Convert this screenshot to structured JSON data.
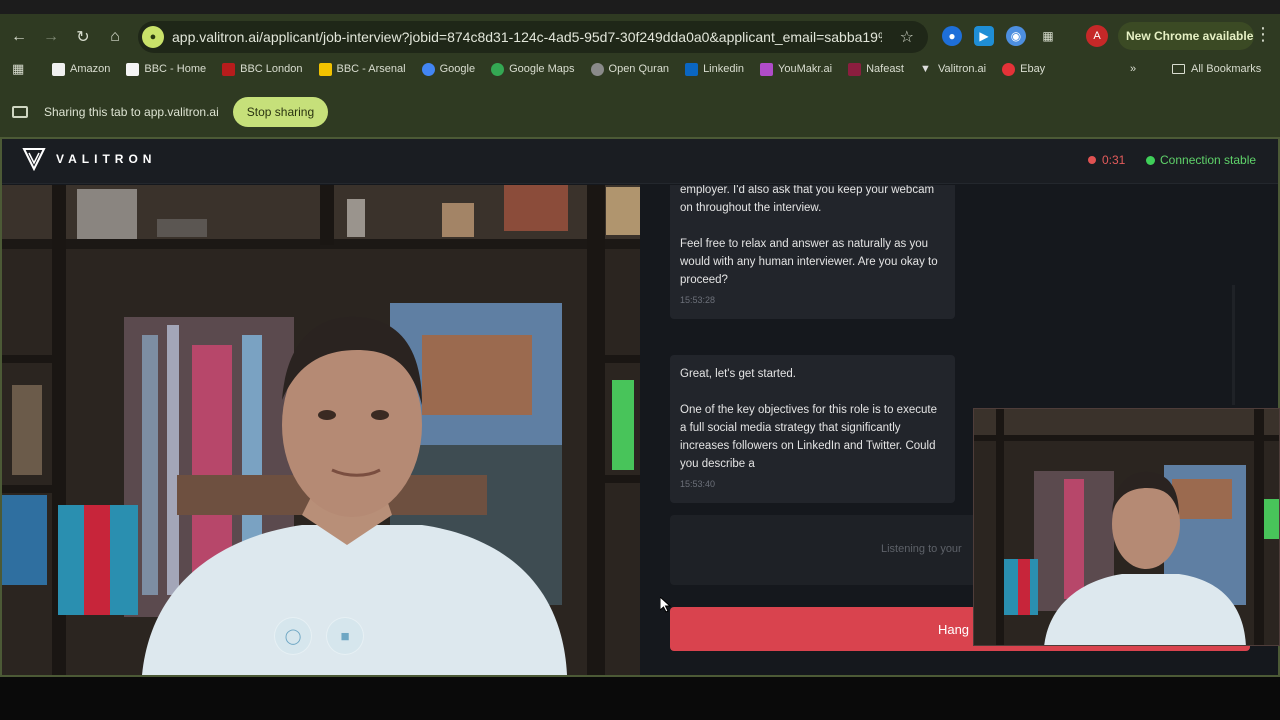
{
  "browser": {
    "url": "app.valitron.ai/applicant/job-interview?jobid=874c8d31-124c-4ad5-95d7-30f249dda0a0&applicant_email=sabba19%4...",
    "profile_initial": "A",
    "update_label": "New Chrome available",
    "bookmarks": [
      {
        "label": "Amazon",
        "color": "#f0f0f0"
      },
      {
        "label": "BBC - Home",
        "color": "#222222"
      },
      {
        "label": "BBC London",
        "color": "#b71c1c"
      },
      {
        "label": "BBC - Arsenal",
        "color": "#f2c200"
      },
      {
        "label": "Google",
        "color": "#4285f4"
      },
      {
        "label": "Google Maps",
        "color": "#34a853"
      },
      {
        "label": "Open Quran",
        "color": "#8a8a8a"
      },
      {
        "label": "Linkedin",
        "color": "#0a66c2"
      },
      {
        "label": "YouMakr.ai",
        "color": "#b04cc9"
      },
      {
        "label": "Nafeast",
        "color": "#8b1e3f"
      },
      {
        "label": "Valitron.ai",
        "color": "#dddddd"
      },
      {
        "label": "Ebay",
        "color": "#e53238"
      }
    ],
    "all_bookmarks_label": "All Bookmarks",
    "sharing_text": "Sharing this tab to app.valitron.ai",
    "stop_sharing_label": "Stop sharing"
  },
  "app": {
    "brand": "VALITRON",
    "timer": "0:31",
    "connection": "Connection stable",
    "messages": [
      {
        "paragraphs": [
          "employer. I'd also ask that you keep your webcam on throughout the interview.",
          "Feel free to relax and answer as naturally as you would with any human interviewer. Are you okay to proceed?"
        ],
        "time": "15:53:28"
      },
      {
        "paragraphs": [
          "Great, let's get started.",
          "One of the key objectives for this role is to execute a full social media strategy that significantly increases followers on LinkedIn and Twitter. Could you describe a"
        ],
        "time": "15:53:40"
      }
    ],
    "listening_text": "Listening to your",
    "hangup_label": "Hang U"
  },
  "colors": {
    "accent": "#c6e07a",
    "hangup": "#d9434e",
    "status_green": "#3fcf59",
    "record_red": "#e05252"
  }
}
